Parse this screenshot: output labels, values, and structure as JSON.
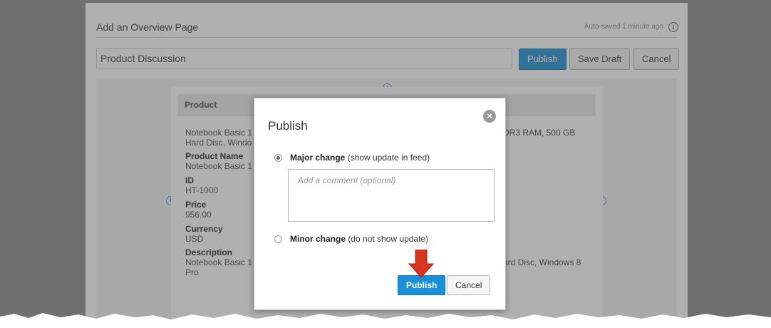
{
  "header": {
    "title": "Add an Overview Page",
    "autosave": "Auto-saved 1 minute ago",
    "info_icon": "i"
  },
  "title_input": {
    "value": "Product Discussion"
  },
  "toolbar": {
    "publish": "Publish",
    "save_draft": "Save Draft",
    "cancel": "Cancel"
  },
  "card": {
    "header": "Product",
    "summary_line1": "Notebook Basic 1",
    "summary_line2": "Hard Disc, Windo",
    "summary_right": "DR3 RAM, 500 GB",
    "fields": [
      {
        "label": "Product Name",
        "value": "Notebook Basic 1"
      },
      {
        "label": "ID",
        "value": "HT-1000"
      },
      {
        "label": "Price",
        "value": "956.00"
      },
      {
        "label": "Currency",
        "value": "USD"
      },
      {
        "label": "Description",
        "value": "Notebook Basic 1"
      }
    ],
    "desc_line2": "Pro",
    "desc_right": "ard Disc, Windows 8"
  },
  "dialog": {
    "title": "Publish",
    "close_icon": "×",
    "major_label": "Major change",
    "major_hint": "(show update in feed)",
    "comment_placeholder": "Add a comment (optional)",
    "minor_label": "Minor change",
    "minor_hint": "(do not show update)",
    "publish": "Publish",
    "cancel": "Cancel",
    "selected_option": "major"
  },
  "colors": {
    "primary": "#1a8fd6",
    "arrow": "#d9341f"
  }
}
